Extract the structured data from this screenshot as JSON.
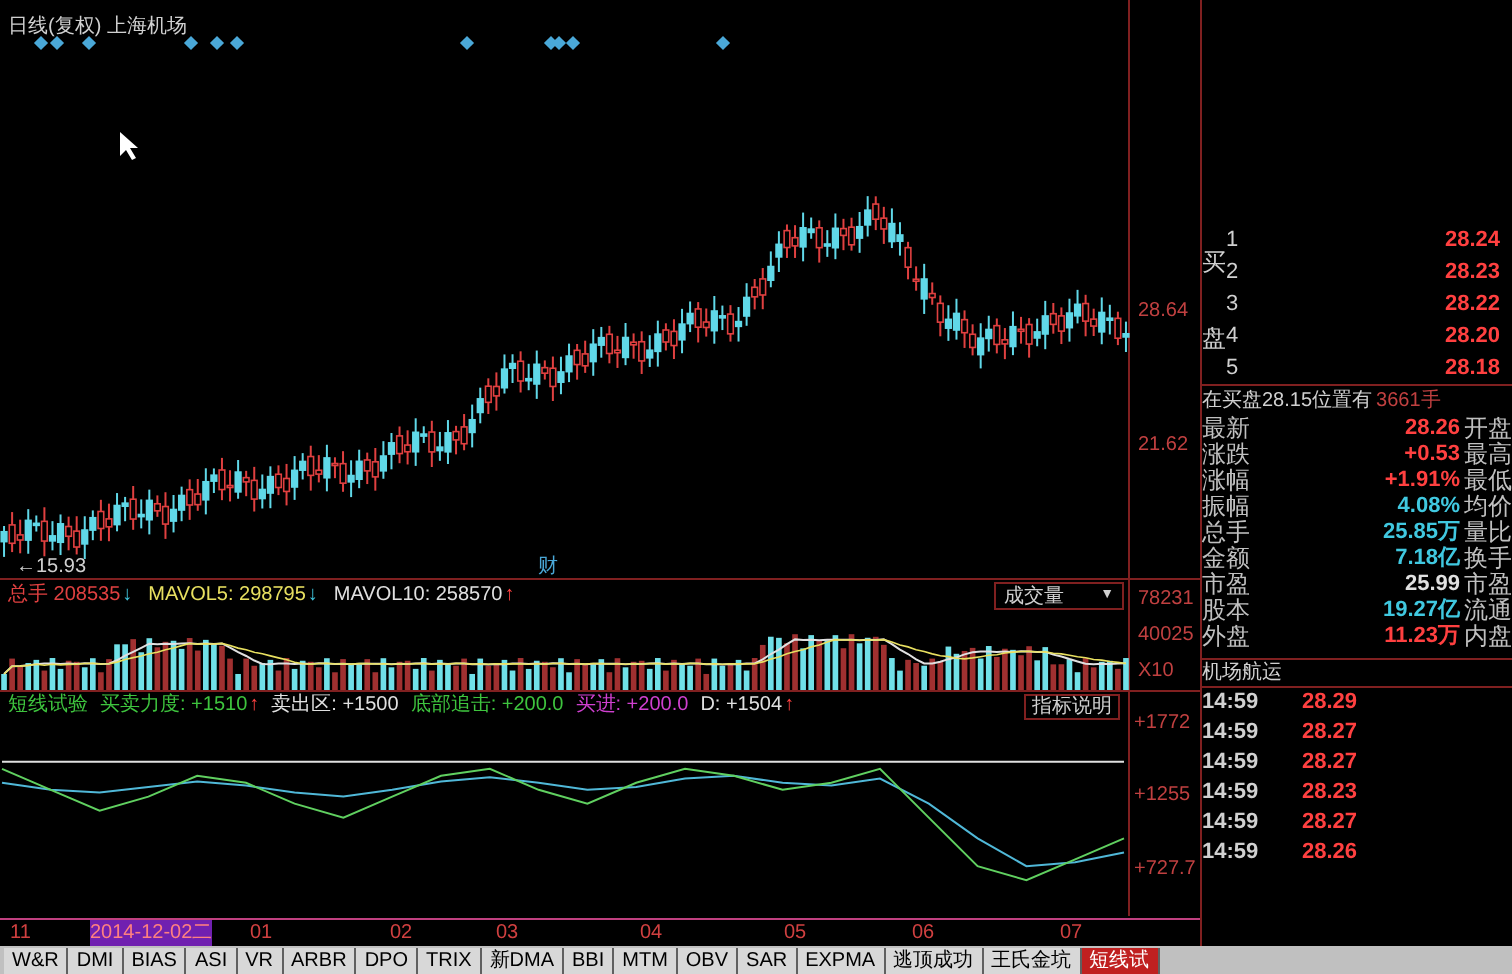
{
  "chart": {
    "title": "日线(复权) 上海机场",
    "low_label": "←15.93",
    "event_mark": "财",
    "axis_labels": [
      "28.64",
      "21.62"
    ]
  },
  "volume": {
    "legend": [
      {
        "label": "总手",
        "value": "208535",
        "arrow": "↓",
        "rising": false,
        "color": "#e04040"
      },
      {
        "label": "MAVOL5:",
        "value": "298795",
        "arrow": "↓",
        "rising": false,
        "color": "#e8e060"
      },
      {
        "label": "MAVOL10:",
        "value": "258570",
        "arrow": "↑",
        "rising": true,
        "color": "#e0e0e0"
      }
    ],
    "dropdown": "成交量",
    "dropdown_caret": "▼",
    "axis_labels": [
      "78231",
      "40025",
      "X10"
    ]
  },
  "indicator": {
    "legend": [
      {
        "label": "短线试验",
        "color": "#3ec43e"
      },
      {
        "label": "买卖力度:",
        "value": "+1510",
        "arrow": "↑",
        "rising": true,
        "color": "#3ec43e"
      },
      {
        "label": "卖出区:",
        "value": "+1500",
        "color": "#e0e0e0"
      },
      {
        "label": "底部追击:",
        "value": "+200.0",
        "color": "#3ec43e"
      },
      {
        "label": "买进:",
        "value": "+200.0",
        "color": "#d040d0"
      },
      {
        "label": "D:",
        "value": "+1504",
        "arrow": "↑",
        "rising": true,
        "color": "#e0e0e0"
      }
    ],
    "help_button": "指标说明",
    "chart_data": {
      "type": "line",
      "ylim": [
        393,
        1800.7
      ],
      "yticks": [
        {
          "value": 1772,
          "label": "+1772"
        },
        {
          "value": 1255,
          "label": "+1255"
        },
        {
          "value": 727.7,
          "label": "+727.7"
        }
      ],
      "series": [
        {
          "color": "#e0e0e0",
          "values": [
            1500,
            1500,
            1500,
            1500,
            1500,
            1500,
            1500,
            1500,
            1500,
            1500,
            1500,
            1500,
            1500,
            1500,
            1500,
            1500,
            1500,
            1500,
            1500,
            1500,
            1500,
            1500,
            1500,
            1500
          ]
        },
        {
          "color": "#50b8d8",
          "values": [
            1350,
            1300,
            1280,
            1320,
            1360,
            1330,
            1280,
            1250,
            1300,
            1360,
            1390,
            1350,
            1300,
            1320,
            1380,
            1400,
            1350,
            1330,
            1380,
            1200,
            950,
            750,
            780,
            850
          ]
        },
        {
          "color": "#60d060",
          "values": [
            1450,
            1300,
            1150,
            1250,
            1400,
            1350,
            1200,
            1100,
            1250,
            1400,
            1450,
            1300,
            1200,
            1350,
            1450,
            1400,
            1300,
            1350,
            1450,
            1100,
            750,
            650,
            800,
            950
          ]
        }
      ]
    }
  },
  "date_axis": [
    {
      "label": "11",
      "selected": false
    },
    {
      "label": "2014-12-02二",
      "selected": true
    },
    {
      "label": "01",
      "selected": false
    },
    {
      "label": "02",
      "selected": false
    },
    {
      "label": "03",
      "selected": false
    },
    {
      "label": "04",
      "selected": false
    },
    {
      "label": "05",
      "selected": false
    },
    {
      "label": "06",
      "selected": false
    },
    {
      "label": "07",
      "selected": false
    }
  ],
  "tabs": [
    {
      "label": "W&R",
      "selected": false
    },
    {
      "label": "DMI",
      "selected": false
    },
    {
      "label": "BIAS",
      "selected": false
    },
    {
      "label": "ASI",
      "selected": false
    },
    {
      "label": "VR",
      "selected": false
    },
    {
      "label": "ARBR",
      "selected": false
    },
    {
      "label": "DPO",
      "selected": false
    },
    {
      "label": "TRIX",
      "selected": false
    },
    {
      "label": "新DMA",
      "selected": false
    },
    {
      "label": "BBI",
      "selected": false
    },
    {
      "label": "MTM",
      "selected": false
    },
    {
      "label": "OBV",
      "selected": false
    },
    {
      "label": "SAR",
      "selected": false
    },
    {
      "label": "EXPMA",
      "selected": false
    },
    {
      "label": "逃顶成功",
      "selected": false
    },
    {
      "label": "王氏金坑",
      "selected": false
    },
    {
      "label": "短线试",
      "selected": true
    }
  ],
  "quote": {
    "side_label": "买盘",
    "orders": [
      {
        "rank": "1",
        "price": "28.24"
      },
      {
        "rank": "2",
        "price": "28.23"
      },
      {
        "rank": "3",
        "price": "28.22"
      },
      {
        "rank": "4",
        "price": "28.20"
      },
      {
        "rank": "5",
        "price": "28.18"
      }
    ],
    "notice": {
      "text": "在买盘28.15位置有",
      "amount": "3661手"
    },
    "stats": [
      {
        "label": "最新",
        "value": "28.26",
        "label2": "开盘",
        "color": "#ff4040"
      },
      {
        "label": "涨跌",
        "value": "+0.53",
        "label2": "最高",
        "color": "#ff4040"
      },
      {
        "label": "涨幅",
        "value": "+1.91%",
        "label2": "最低",
        "color": "#ff4040"
      },
      {
        "label": "振幅",
        "value": "4.08%",
        "label2": "均价",
        "color": "#40c8e0"
      },
      {
        "label": "总手",
        "value": "25.85万",
        "label2": "量比",
        "color": "#40c8e0"
      },
      {
        "label": "金额",
        "value": "7.18亿",
        "label2": "换手",
        "color": "#40c8e0"
      },
      {
        "label": "市盈",
        "value": "25.99",
        "label2": "市盈",
        "color": "#e0e0e0"
      },
      {
        "label": "股本",
        "value": "19.27亿",
        "label2": "流通",
        "color": "#40c8e0"
      },
      {
        "label": "外盘",
        "value": "11.23万",
        "label2": "内盘",
        "color": "#ff4040"
      }
    ],
    "ticks_title": "机场航运",
    "ticks": [
      {
        "time": "14:59",
        "price": "28.29"
      },
      {
        "time": "14:59",
        "price": "28.27"
      },
      {
        "time": "14:59",
        "price": "28.27"
      },
      {
        "time": "14:59",
        "price": "28.23"
      },
      {
        "time": "14:59",
        "price": "28.27"
      },
      {
        "time": "14:59",
        "price": "28.26"
      }
    ]
  }
}
